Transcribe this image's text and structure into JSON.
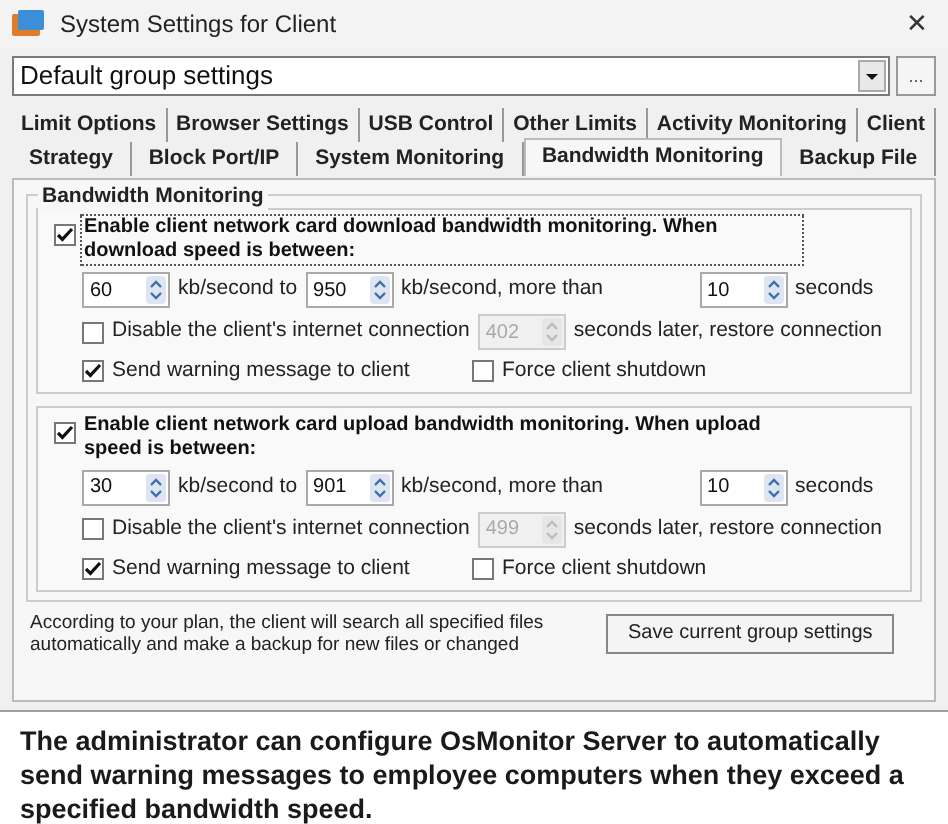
{
  "window": {
    "title": "System Settings for Client",
    "close": "✕"
  },
  "group_select": {
    "value": "Default group settings",
    "more_button": "..."
  },
  "tab_rows": [
    [
      {
        "label": "Limit Options",
        "selected": false
      },
      {
        "label": "Browser Settings",
        "selected": false
      },
      {
        "label": "USB Control",
        "selected": false
      },
      {
        "label": "Other Limits",
        "selected": false
      },
      {
        "label": "Activity Monitoring",
        "selected": false
      },
      {
        "label": "Client",
        "selected": false
      }
    ],
    [
      {
        "label": "Strategy",
        "selected": false
      },
      {
        "label": "Block Port/IP",
        "selected": false
      },
      {
        "label": "System Monitoring",
        "selected": false
      },
      {
        "label": "Bandwidth Monitoring",
        "selected": true
      },
      {
        "label": "Backup File",
        "selected": false
      }
    ]
  ],
  "group_box": {
    "title": "Bandwidth Monitoring",
    "sections": [
      {
        "enable": {
          "label": "Enable client network card download bandwidth monitoring. When download speed is between:",
          "checked": true,
          "focused": true
        },
        "from": {
          "value": "60",
          "unit": "kb/second to"
        },
        "to": {
          "value": "950",
          "unit": "kb/second, more than"
        },
        "duration": {
          "value": "10",
          "unit": "seconds"
        },
        "disable": {
          "label": "Disable the client's internet connection",
          "checked": false,
          "value": "402",
          "value_disabled": true,
          "suffix": "seconds later, restore connection"
        },
        "warn": {
          "label": "Send warning message to client",
          "checked": true
        },
        "shutdown": {
          "label": "Force client shutdown",
          "checked": false
        }
      },
      {
        "enable": {
          "label": "Enable client network card upload bandwidth monitoring. When upload speed is between:",
          "checked": true,
          "focused": false
        },
        "from": {
          "value": "30",
          "unit": "kb/second to"
        },
        "to": {
          "value": "901",
          "unit": "kb/second, more than"
        },
        "duration": {
          "value": "10",
          "unit": "seconds"
        },
        "disable": {
          "label": "Disable the client's internet connection",
          "checked": false,
          "value": "499",
          "value_disabled": true,
          "suffix": "seconds later, restore connection"
        },
        "warn": {
          "label": "Send warning message to client",
          "checked": true
        },
        "shutdown": {
          "label": "Force client shutdown",
          "checked": false
        }
      }
    ]
  },
  "footer": {
    "note": "According to your plan, the client will search all specified files automatically and make a backup for new files or changed",
    "save_button": "Save current group settings"
  },
  "caption": "The administrator can configure OsMonitor Server to automatically send warning messages to employee computers when they exceed a specified bandwidth speed."
}
